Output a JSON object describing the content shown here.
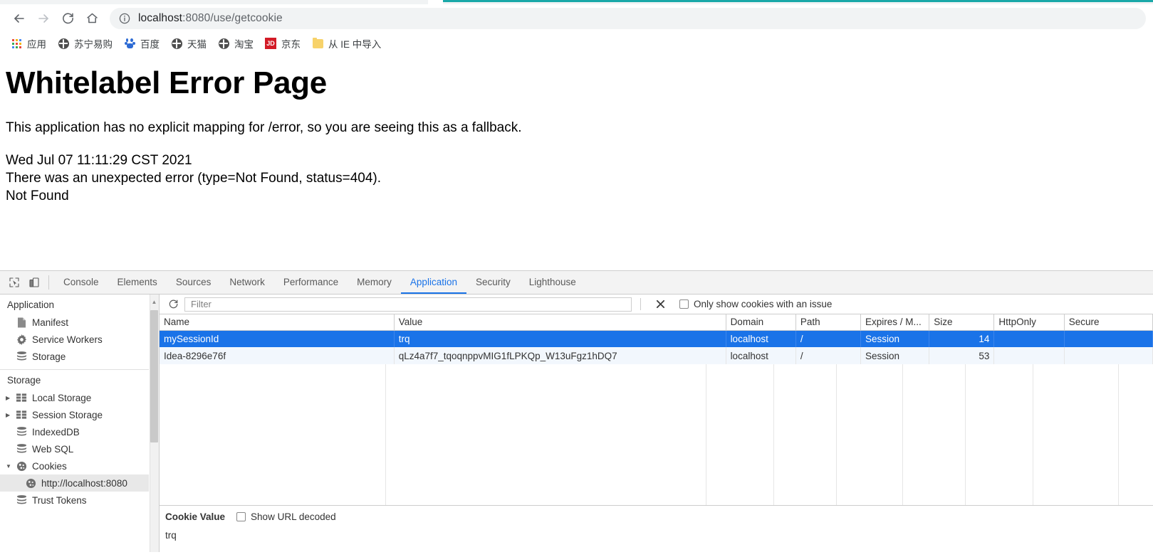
{
  "browser": {
    "nav": {
      "back": "back-arrow",
      "forward": "forward-arrow",
      "reload": "reload",
      "home": "home"
    },
    "omnibox": {
      "info_icon": "site-information",
      "url_host": "localhost",
      "url_rest": ":8080/use/getcookie",
      "full_url": "localhost:8080/use/getcookie"
    },
    "bookmarks": [
      {
        "label": "应用",
        "icon": "apps-grid-icon"
      },
      {
        "label": "苏宁易购",
        "icon": "globe-icon"
      },
      {
        "label": "百度",
        "icon": "baidu-paw-icon"
      },
      {
        "label": "天猫",
        "icon": "globe-icon"
      },
      {
        "label": "淘宝",
        "icon": "globe-icon"
      },
      {
        "label": "京东",
        "icon": "jd-logo-icon"
      },
      {
        "label": "从 IE 中导入",
        "icon": "folder-icon"
      }
    ]
  },
  "page": {
    "heading": "Whitelabel Error Page",
    "paragraph1": "This application has no explicit mapping for /error, so you are seeing this as a fallback.",
    "line_timestamp": "Wed Jul 07 11:11:29 CST 2021",
    "line_error": "There was an unexpected error (type=Not Found, status=404).",
    "line_status": "Not Found"
  },
  "devtools": {
    "toolbar_icons": {
      "inspect": "inspect-element-icon",
      "device": "device-toolbar-icon"
    },
    "tabs": [
      {
        "label": "Console",
        "active": false
      },
      {
        "label": "Elements",
        "active": false
      },
      {
        "label": "Sources",
        "active": false
      },
      {
        "label": "Network",
        "active": false
      },
      {
        "label": "Performance",
        "active": false
      },
      {
        "label": "Memory",
        "active": false
      },
      {
        "label": "Application",
        "active": true
      },
      {
        "label": "Security",
        "active": false
      },
      {
        "label": "Lighthouse",
        "active": false
      }
    ],
    "sidebar": {
      "section1_title": "Application",
      "section1_items": [
        {
          "label": "Manifest",
          "icon": "manifest-document-icon"
        },
        {
          "label": "Service Workers",
          "icon": "gear-icon"
        },
        {
          "label": "Storage",
          "icon": "database-icon"
        }
      ],
      "section2_title": "Storage",
      "section2_items": [
        {
          "label": "Local Storage",
          "icon": "table-icon",
          "twisty": "collapsed",
          "indent": 1,
          "selected": false
        },
        {
          "label": "Session Storage",
          "icon": "table-icon",
          "twisty": "collapsed",
          "indent": 1,
          "selected": false
        },
        {
          "label": "IndexedDB",
          "icon": "database-icon",
          "twisty": "none",
          "indent": 1,
          "selected": false
        },
        {
          "label": "Web SQL",
          "icon": "database-icon",
          "twisty": "none",
          "indent": 1,
          "selected": false
        },
        {
          "label": "Cookies",
          "icon": "cookie-icon",
          "twisty": "expanded",
          "indent": 1,
          "selected": false
        },
        {
          "label": "http://localhost:8080",
          "icon": "cookie-icon",
          "twisty": "none",
          "indent": 2,
          "selected": true
        },
        {
          "label": "Trust Tokens",
          "icon": "database-icon",
          "twisty": "none",
          "indent": 1,
          "selected": false
        }
      ]
    },
    "cookie_toolbar": {
      "refresh_icon": "refresh-icon",
      "filter_placeholder": "Filter",
      "filter_value": "",
      "clear_icon": "clear-all-cookies-icon",
      "issue_checkbox_label": "Only show cookies with an issue",
      "issue_checkbox_checked": false
    },
    "cookie_table": {
      "columns": [
        "Name",
        "Value",
        "Domain",
        "Path",
        "Expires / M...",
        "Size",
        "HttpOnly",
        "Secure"
      ],
      "rows": [
        {
          "name": "mySessionId",
          "value": "trq",
          "domain": "localhost",
          "path": "/",
          "expires": "Session",
          "size": "14",
          "httponly": "",
          "secure": "",
          "selected": true
        },
        {
          "name": "Idea-8296e76f",
          "value": "qLz4a7f7_tqoqnppvMIG1fLPKQp_W13uFgz1hDQ7",
          "domain": "localhost",
          "path": "/",
          "expires": "Session",
          "size": "53",
          "httponly": "",
          "secure": "",
          "selected": false
        }
      ]
    },
    "cookie_detail": {
      "title": "Cookie Value",
      "url_decoded_label": "Show URL decoded",
      "url_decoded_checked": false,
      "value": "trq"
    }
  },
  "colors": {
    "accent_blue": "#1a73e8",
    "tab_teal": "#1aa8a8",
    "selection_blue": "#1a73e8",
    "jd_red": "#d31b27",
    "baidu_blue": "#2d6bd4"
  }
}
